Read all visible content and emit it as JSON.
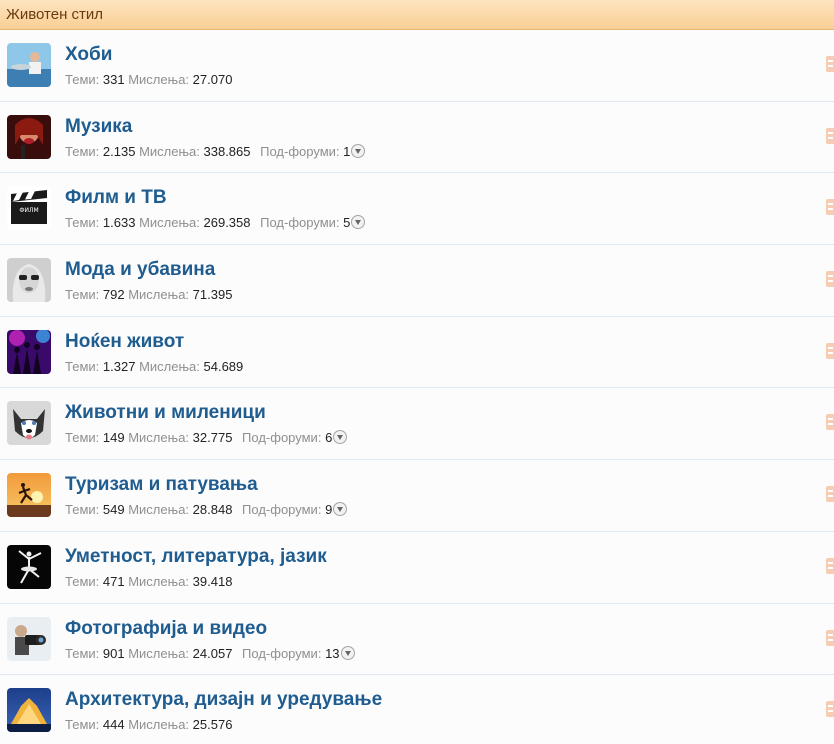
{
  "category": {
    "title": "Животен стил"
  },
  "labels": {
    "themes": "Теми:",
    "posts": "Мислења:",
    "subforums": "Под-форуми:"
  },
  "forums": [
    {
      "title": "Хоби",
      "icon": "hobby-fisherman-icon",
      "themes": "331",
      "posts": "27.070",
      "subforums": null
    },
    {
      "title": "Музика",
      "icon": "music-singer-icon",
      "themes": "2.135",
      "posts": "338.865",
      "subforums": "1"
    },
    {
      "title": "Филм и ТВ",
      "icon": "film-clapperboard-icon",
      "themes": "1.633",
      "posts": "269.358",
      "subforums": "5"
    },
    {
      "title": "Мода и убавина",
      "icon": "fashion-woman-sunglasses-icon",
      "themes": "792",
      "posts": "71.395",
      "subforums": null
    },
    {
      "title": "Ноќен живот",
      "icon": "nightlife-party-icon",
      "themes": "1.327",
      "posts": "54.689",
      "subforums": null
    },
    {
      "title": "Животни и миленици",
      "icon": "husky-dog-icon",
      "themes": "149",
      "posts": "32.775",
      "subforums": "6"
    },
    {
      "title": "Туризам и патувања",
      "icon": "sunset-runner-icon",
      "themes": "549",
      "posts": "28.848",
      "subforums": "9"
    },
    {
      "title": "Уметност, литература, јазик",
      "icon": "ballet-dancer-icon",
      "themes": "471",
      "posts": "39.418",
      "subforums": null
    },
    {
      "title": "Фотографија и видео",
      "icon": "photographer-camera-icon",
      "themes": "901",
      "posts": "24.057",
      "subforums": "13"
    },
    {
      "title": "Архитектура, дизајн и уредување",
      "icon": "architecture-building-icon",
      "themes": "444",
      "posts": "25.576",
      "subforums": null
    }
  ]
}
